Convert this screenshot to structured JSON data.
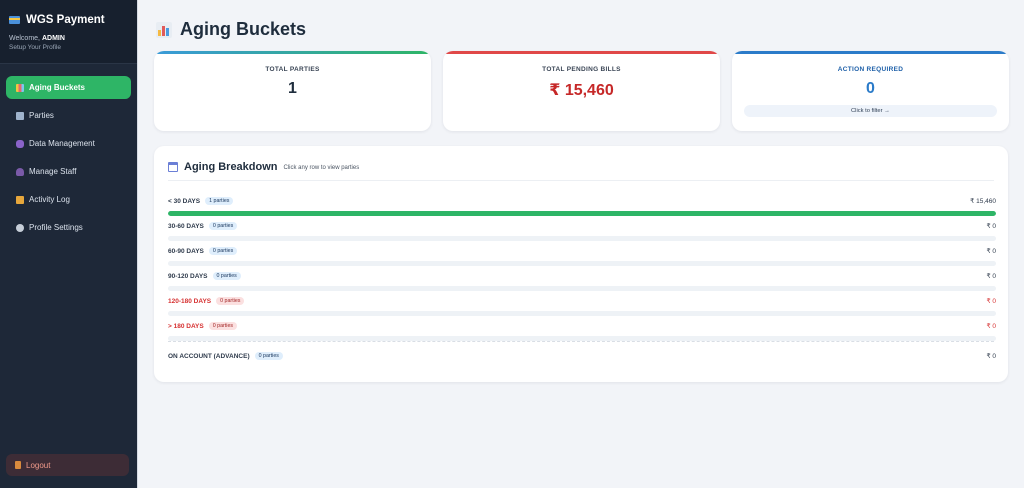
{
  "brand": {
    "title": "WGS Payment",
    "welcome_prefix": "Welcome,",
    "user": "ADMIN",
    "setup": "Setup Your Profile"
  },
  "nav": {
    "items": [
      {
        "label": "Aging Buckets",
        "icon": "chart-icon",
        "active": true
      },
      {
        "label": "Parties",
        "icon": "building-icon",
        "active": false
      },
      {
        "label": "Data Management",
        "icon": "database-icon",
        "active": false
      },
      {
        "label": "Manage Staff",
        "icon": "user-icon",
        "active": false
      },
      {
        "label": "Activity Log",
        "icon": "scroll-icon",
        "active": false
      },
      {
        "label": "Profile Settings",
        "icon": "gear-icon",
        "active": false
      }
    ],
    "logout": "Logout"
  },
  "page": {
    "title": "Aging Buckets"
  },
  "stats": {
    "total_parties": {
      "label": "TOTAL PARTIES",
      "value": "1",
      "color": "#1f2d3d",
      "accent": "#3a9ad9"
    },
    "pending_bills": {
      "label": "TOTAL PENDING BILLS",
      "value": "₹ 15,460",
      "color": "#c62828",
      "accent": "#e04848"
    },
    "action_required": {
      "label": "ACTION REQUIRED",
      "value": "0",
      "color": "#2b7bc9",
      "accent": "#2b7bc9",
      "button": "Click to filter →"
    }
  },
  "breakdown": {
    "title": "Aging Breakdown",
    "subtitle": "Click any row to view parties",
    "rows": [
      {
        "label": "< 30 DAYS",
        "parties": "1 parties",
        "amount": "₹ 15,460",
        "fraction": 1.0,
        "warn": false
      },
      {
        "label": "30-60 DAYS",
        "parties": "0 parties",
        "amount": "₹ 0",
        "fraction": 0,
        "warn": false
      },
      {
        "label": "60-90 DAYS",
        "parties": "0 parties",
        "amount": "₹ 0",
        "fraction": 0,
        "warn": false
      },
      {
        "label": "90-120 DAYS",
        "parties": "0 parties",
        "amount": "₹ 0",
        "fraction": 0,
        "warn": false
      },
      {
        "label": "120-180 DAYS",
        "parties": "0 parties",
        "amount": "₹ 0",
        "fraction": 0,
        "warn": true
      },
      {
        "label": "> 180 DAYS",
        "parties": "0 parties",
        "amount": "₹ 0",
        "fraction": 0,
        "warn": true
      }
    ],
    "on_account": {
      "label": "ON ACCOUNT (ADVANCE)",
      "parties": "0 parties",
      "amount": "₹ 0"
    }
  },
  "colors": {
    "brand_green": "#2eb566",
    "sidebar_bg": "#1e2838",
    "danger": "#d63030"
  }
}
